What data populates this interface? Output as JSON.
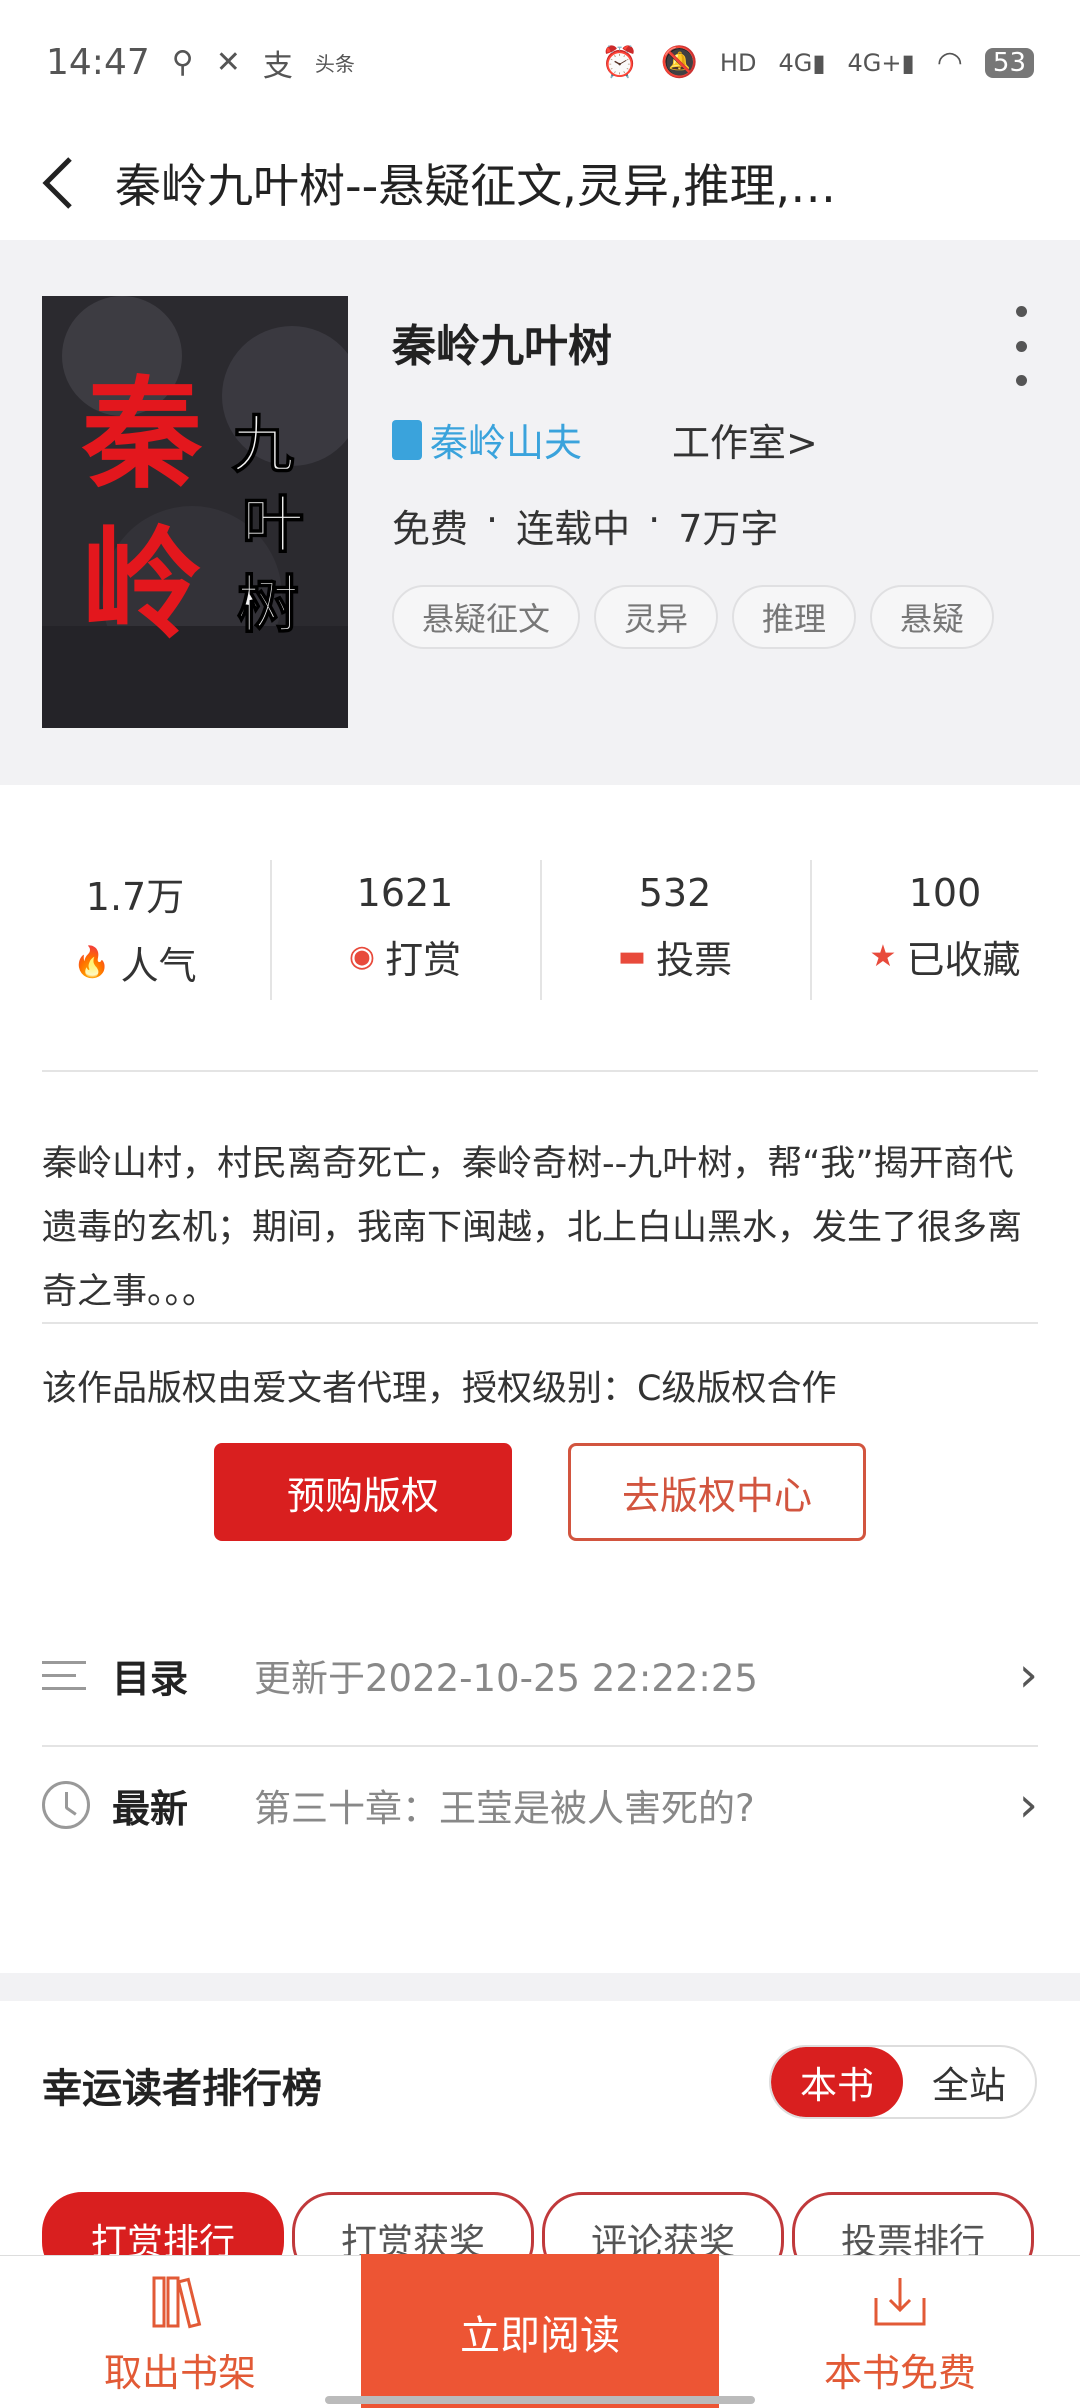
{
  "status_bar": {
    "time": "14:47",
    "icons": [
      "location-icon",
      "figure-icon",
      "alipay-icon",
      "toutiao-icon",
      "alarm-icon",
      "mute-icon",
      "hd-icon",
      "signal-4g-icon",
      "signal-4g-plus-icon",
      "wifi-icon"
    ],
    "battery": "53"
  },
  "app_bar": {
    "back_icon": "chevron-left-icon",
    "title": "秦岭九叶树--悬疑征文,灵异,推理,…"
  },
  "book": {
    "cover_text_main": "秦岭",
    "cover_text_sub": "九叶树",
    "title": "秦岭九叶树",
    "author": "秦岭山夫",
    "studio": "工作室>",
    "meta": [
      "免费",
      "·",
      "连载中",
      "·",
      "7万字"
    ],
    "tags": [
      "悬疑征文",
      "灵异",
      "推理",
      "悬疑"
    ]
  },
  "stats": [
    {
      "value": "1.7万",
      "label": "人气",
      "icon": "flame-icon"
    },
    {
      "value": "1621",
      "label": "打赏",
      "icon": "reward-icon"
    },
    {
      "value": "532",
      "label": "投票",
      "icon": "ticket-icon"
    },
    {
      "value": "100",
      "label": "已收藏",
      "icon": "star-icon"
    }
  ],
  "synopsis": "秦岭山村，村民离奇死亡，秦岭奇树--九叶树，帮“我”揭开商代遗毒的玄机；期间，我南下闽越，北上白山黑水，发生了很多离奇之事。。。",
  "license": {
    "text": "该作品版权由爱文者代理，授权级别：C级版权合作",
    "preorder_button": "预购版权",
    "center_button": "去版权中心"
  },
  "catalog": {
    "label": "目录",
    "text": "更新于2022-10-25 22:22:25"
  },
  "latest": {
    "label": "最新",
    "text": "第三十章：王莹是被人害死的?"
  },
  "ranking": {
    "title": "幸运读者排行榜",
    "scope_options": [
      "本书",
      "全站"
    ],
    "tabs": [
      "打赏排行",
      "打赏获奖",
      "评论获奖",
      "投票排行"
    ]
  },
  "bottom_bar": {
    "left_label": "取出书架",
    "cta_label": "立即阅读",
    "right_label": "本书免费"
  },
  "colors": {
    "accent_red": "#d91f1f",
    "cta_orange": "#ed5534",
    "author_blue": "#3aa3dc"
  }
}
